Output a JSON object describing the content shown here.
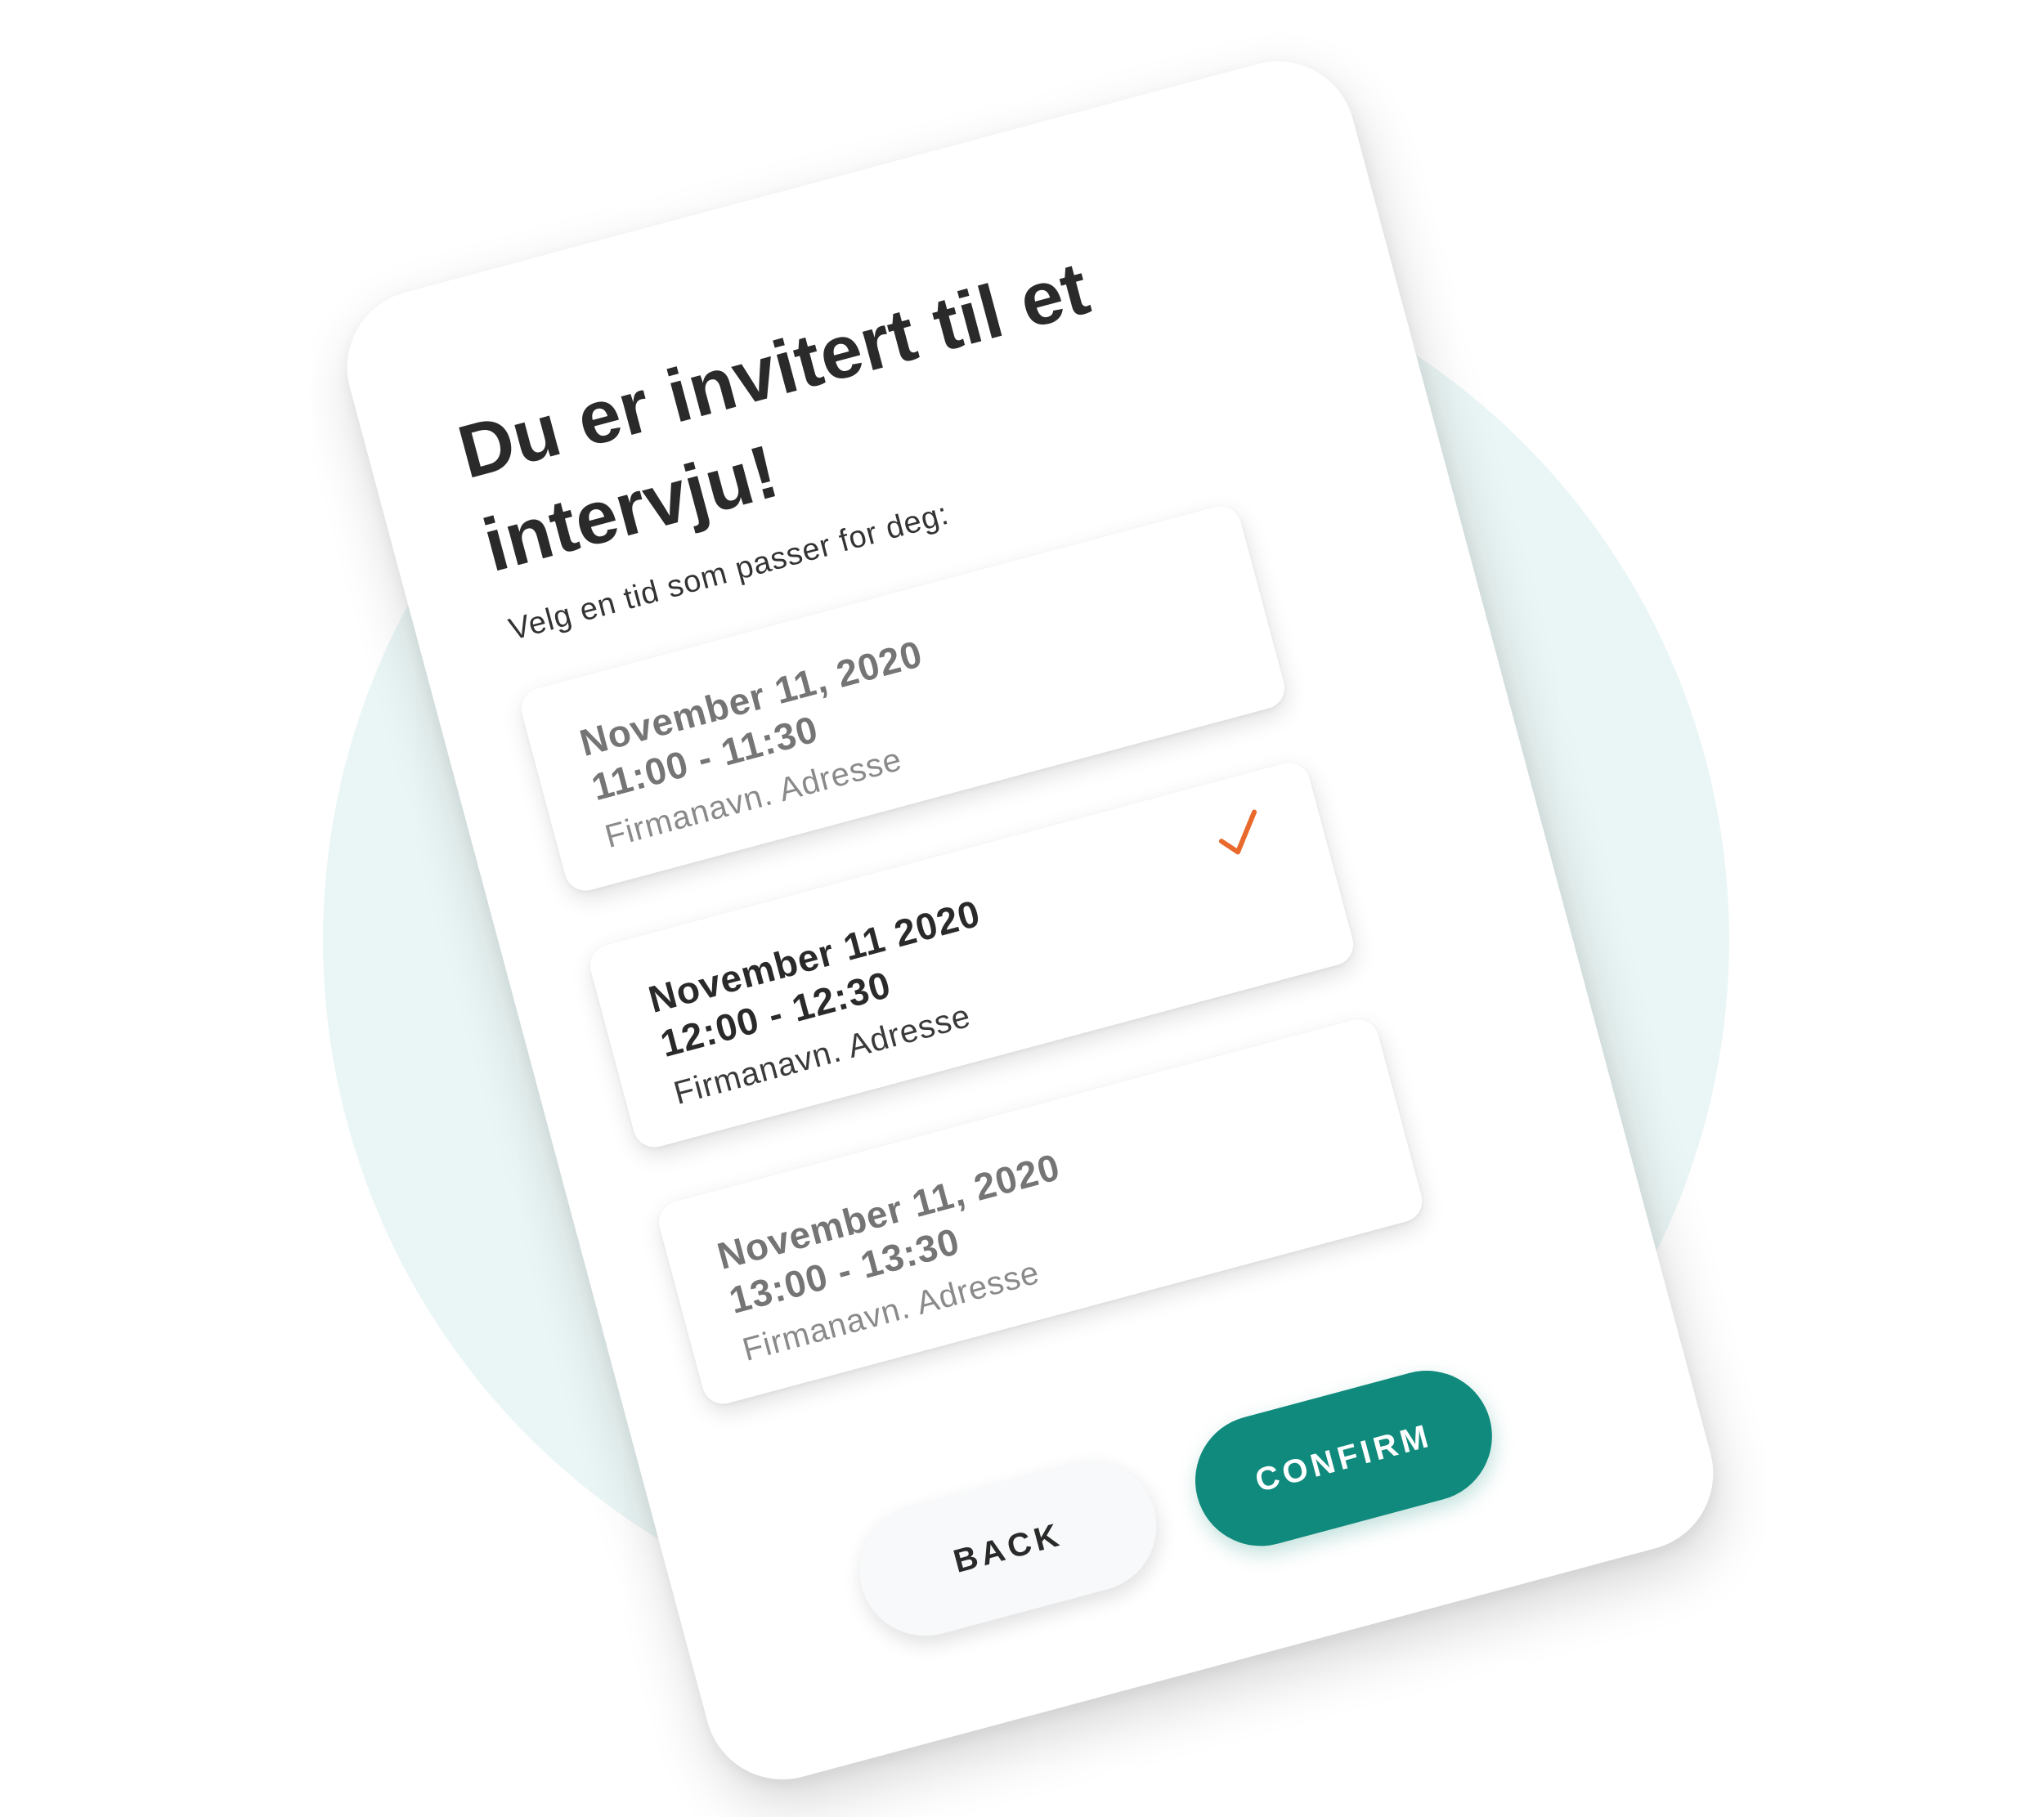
{
  "header": {
    "title": "Du er invitert til et intervju!",
    "subtitle": "Velg en tid som passer for deg:"
  },
  "slots": [
    {
      "date": "November 11, 2020",
      "time": "11:00 - 11:30",
      "location": "Firmanavn. Adresse",
      "selected": false
    },
    {
      "date": "November 11 2020",
      "time": "12:00 - 12:30",
      "location": "Firmanavn. Adresse",
      "selected": true,
      "icon": "check-icon"
    },
    {
      "date": "November 11, 2020",
      "time": "13:00 - 13:30",
      "location": "Firmanavn. Adresse",
      "selected": false
    }
  ],
  "actions": {
    "back_label": "BACK",
    "confirm_label": "CONFIRM"
  },
  "colors": {
    "accent": "#0f8a7c",
    "check": "#e8692b",
    "background_circle": "#eaf6f5"
  }
}
